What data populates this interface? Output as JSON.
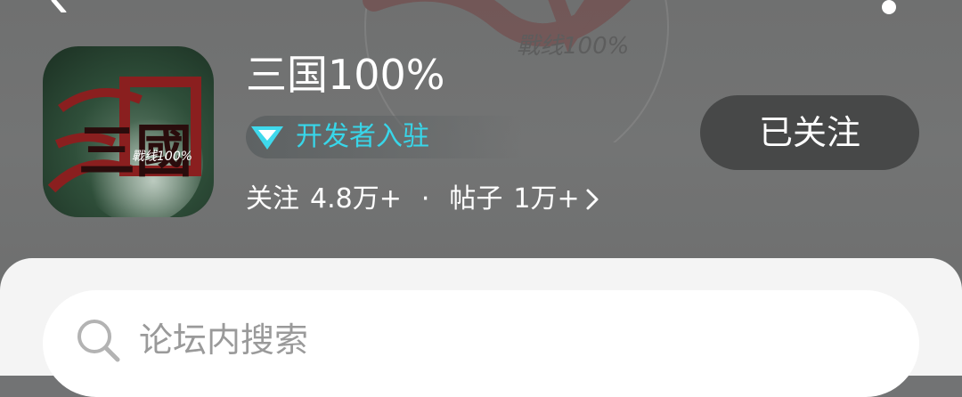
{
  "header": {
    "app_title": "三国100%",
    "badge_label": "开发者入驻",
    "stats": {
      "follow_label": "关注",
      "follow_count": "4.8万+",
      "separator": "·",
      "posts_label": "帖子",
      "posts_count": "1万+"
    },
    "follow_button_label": "已关注",
    "icon_text": "三國",
    "icon_subtext": "戰线100%",
    "watermark_text": "戰线100%"
  },
  "search": {
    "placeholder": "论坛内搜索"
  },
  "colors": {
    "header_bg": "#727374",
    "badge_text": "#38d6e9",
    "button_bg": "#474848",
    "sheet_bg": "#f4f4f4"
  },
  "icons": [
    "back-chevron-icon",
    "more-icon",
    "diamond-icon",
    "chevron-right-icon",
    "search-icon"
  ]
}
